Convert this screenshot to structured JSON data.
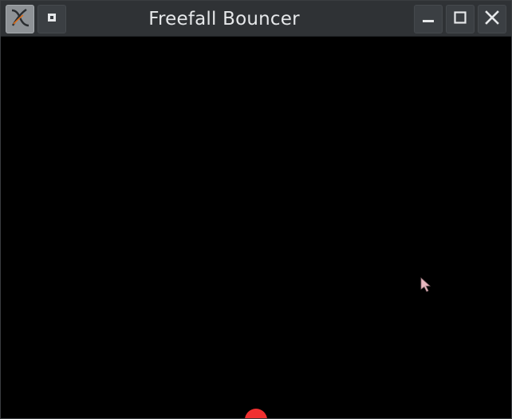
{
  "window": {
    "title": "Freefall Bouncer"
  },
  "titlebar": {
    "app_icon": "x-app-icon",
    "buttons": [
      "pin",
      "minimize",
      "maximize",
      "close"
    ]
  },
  "scene": {
    "background_color": "#000000",
    "ball_color": "#f03030",
    "cursor_icon": "pointer-arrow-icon"
  }
}
